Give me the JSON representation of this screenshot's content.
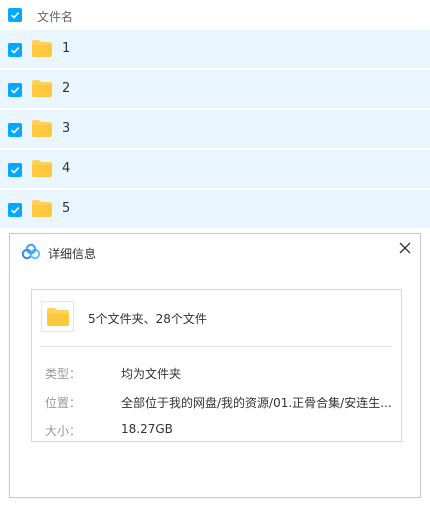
{
  "list": {
    "header_label": "文件名",
    "items": [
      {
        "name": "1"
      },
      {
        "name": "2"
      },
      {
        "name": "3"
      },
      {
        "name": "4"
      },
      {
        "name": "5"
      }
    ]
  },
  "dialog": {
    "title": "详细信息",
    "summary": "5个文件夹、28个文件",
    "properties": [
      {
        "label": "类型：",
        "value": "均为文件夹"
      },
      {
        "label": "位置：",
        "value": "全部位于我的网盘/我的资源/01.正骨合集/安连生..."
      },
      {
        "label": "大小：",
        "value": "18.27GB"
      }
    ]
  },
  "colors": {
    "accent": "#06a7ff",
    "row_selected": "#e9f6ff",
    "folder": "#ffd25c"
  },
  "icons": {
    "checkbox": "checkbox-checked-icon",
    "folder": "folder-icon",
    "close": "close-icon",
    "logo": "cloud-logo-icon"
  }
}
